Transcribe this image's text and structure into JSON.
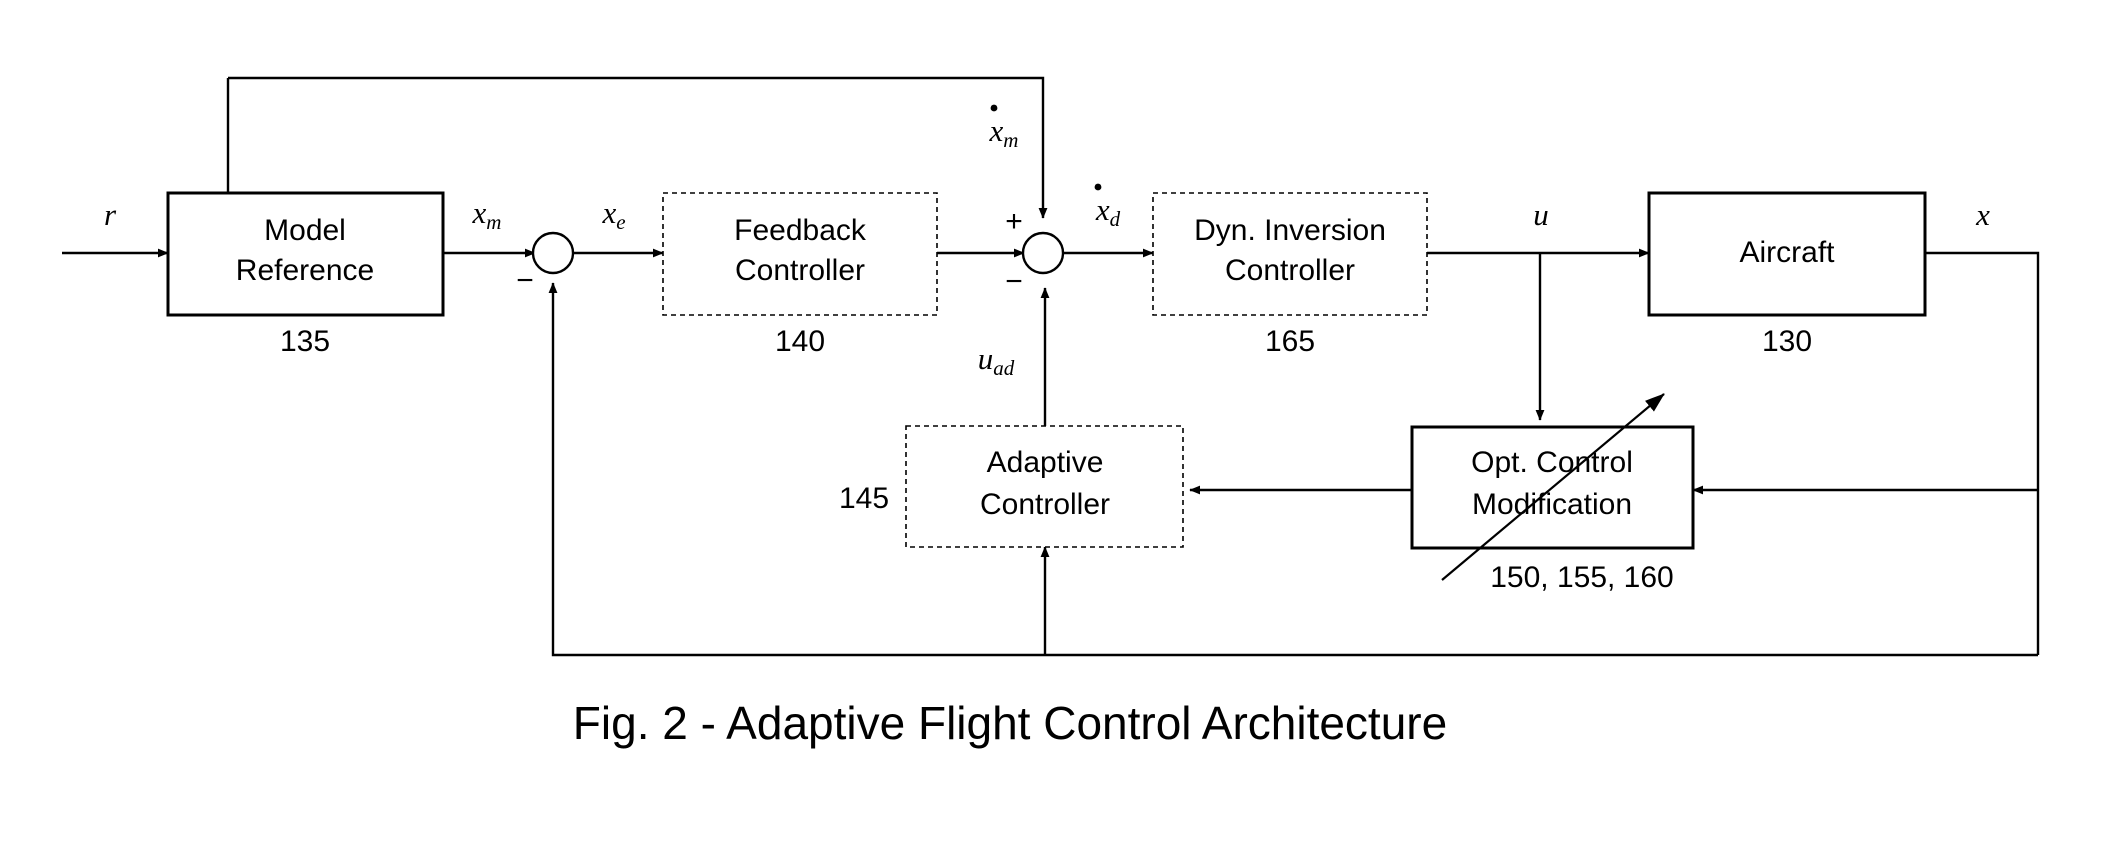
{
  "figure": {
    "caption": "Fig. 2 - Adaptive Flight Control Architecture",
    "domain": "control-system-block-diagram"
  },
  "blocks": [
    {
      "id": "model-reference",
      "line1": "Model",
      "line2": "Reference",
      "ref": "135",
      "border": "solid"
    },
    {
      "id": "feedback-controller",
      "line1": "Feedback",
      "line2": "Controller",
      "ref": "140",
      "border": "dashed"
    },
    {
      "id": "dyn-inversion-controller",
      "line1": "Dyn. Inversion",
      "line2": "Controller",
      "ref": "165",
      "border": "dashed"
    },
    {
      "id": "aircraft",
      "line1": "Aircraft",
      "line2": "",
      "ref": "130",
      "border": "solid"
    },
    {
      "id": "adaptive-controller",
      "line1": "Adaptive",
      "line2": "Controller",
      "ref": "145",
      "border": "dashed"
    },
    {
      "id": "opt-control-modification",
      "line1": "Opt. Control",
      "line2": "Modification",
      "ref": "150, 155, 160",
      "border": "solid"
    }
  ],
  "signals": {
    "reference_input": "r",
    "model_state": "x",
    "model_state_sub": "m",
    "error": "x",
    "error_sub": "e",
    "model_rate": "x",
    "model_rate_sub": "m",
    "desired_rate": "x",
    "desired_rate_sub": "d",
    "control": "u",
    "adaptive_control": "u",
    "adaptive_control_sub": "ad",
    "aircraft_state": "x"
  },
  "summing_junctions": [
    {
      "id": "error-junction",
      "signs": {
        "left": "",
        "bottom_left": "−"
      }
    },
    {
      "id": "rate-junction",
      "signs": {
        "top_left": "+",
        "bottom_left": "−"
      }
    }
  ],
  "colors": {
    "stroke": "#000000",
    "fill": "#ffffff",
    "background": "#ffffff"
  }
}
